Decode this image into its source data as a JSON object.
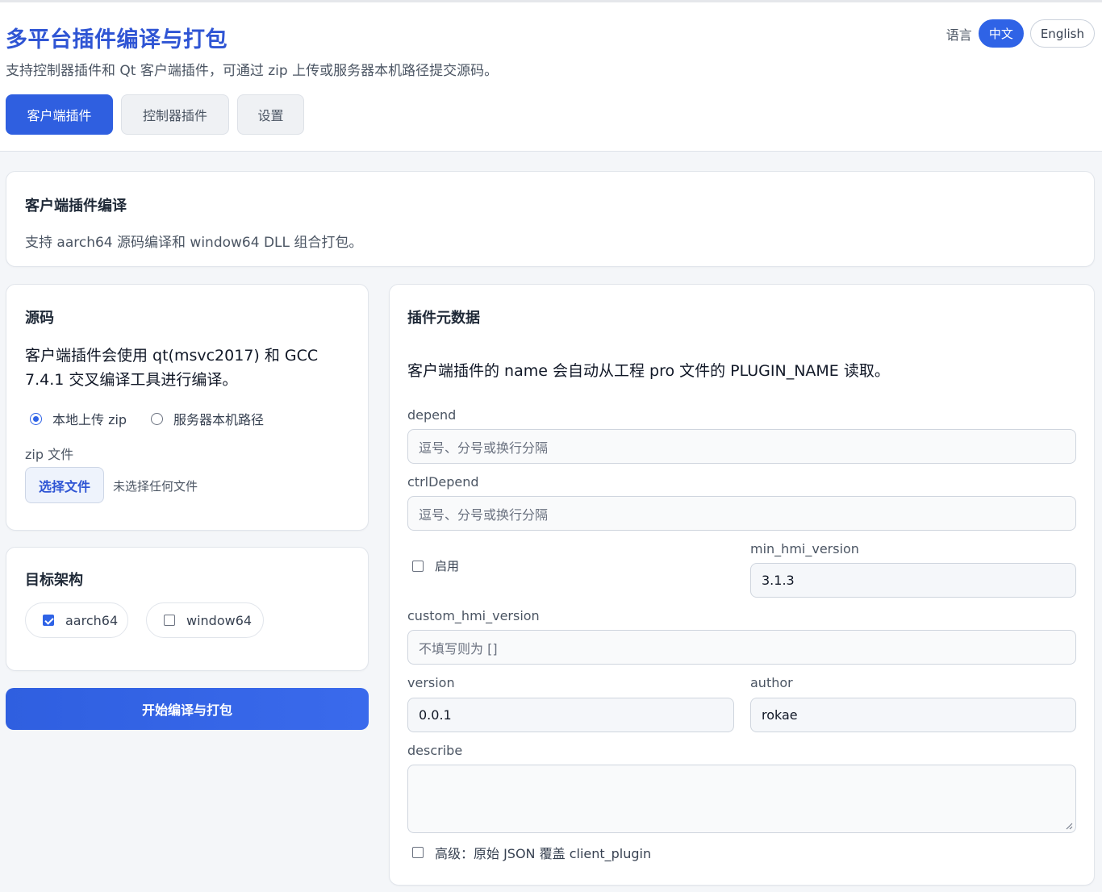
{
  "header": {
    "title": "多平台插件编译与打包",
    "subtitle": "支持控制器插件和 Qt 客户端插件，可通过 zip 上传或服务器本机路径提交源码。",
    "language_label": "语言",
    "lang_zh": "中文",
    "lang_en": "English"
  },
  "tabs": [
    "客户端插件",
    "控制器插件",
    "设置"
  ],
  "intro": {
    "title": "客户端插件编译",
    "description": "支持 aarch64 源码编译和 window64 DLL 组合打包。"
  },
  "source": {
    "title": "源码",
    "description": "客户端插件会使用 qt(msvc2017) 和 GCC 7.4.1 交叉编译工具进行编译。",
    "radio_local": "本地上传 zip",
    "radio_server": "服务器本机路径",
    "zip_label": "zip 文件",
    "choose_button": "选择文件",
    "no_file": "未选择任何文件"
  },
  "arch": {
    "title": "目标架构",
    "aarch64": "aarch64",
    "window64": "window64"
  },
  "build_button": "开始编译与打包",
  "metadata": {
    "title": "插件元数据",
    "note": "客户端插件的 name 会自动从工程 pro 文件的 PLUGIN_NAME 读取。",
    "depend_label": "depend",
    "depend_placeholder": "逗号、分号或换行分隔",
    "ctrl_depend_label": "ctrlDepend",
    "ctrl_depend_placeholder": "逗号、分号或换行分隔",
    "enable_label": "启用",
    "min_hmi_label": "min_hmi_version",
    "min_hmi_value": "3.1.3",
    "custom_hmi_label": "custom_hmi_version",
    "custom_hmi_placeholder": "不填写则为 []",
    "version_label": "version",
    "version_value": "0.0.1",
    "author_label": "author",
    "author_value": "rokae",
    "describe_label": "describe",
    "advanced_label": "高级：原始 JSON 覆盖 client_plugin"
  }
}
